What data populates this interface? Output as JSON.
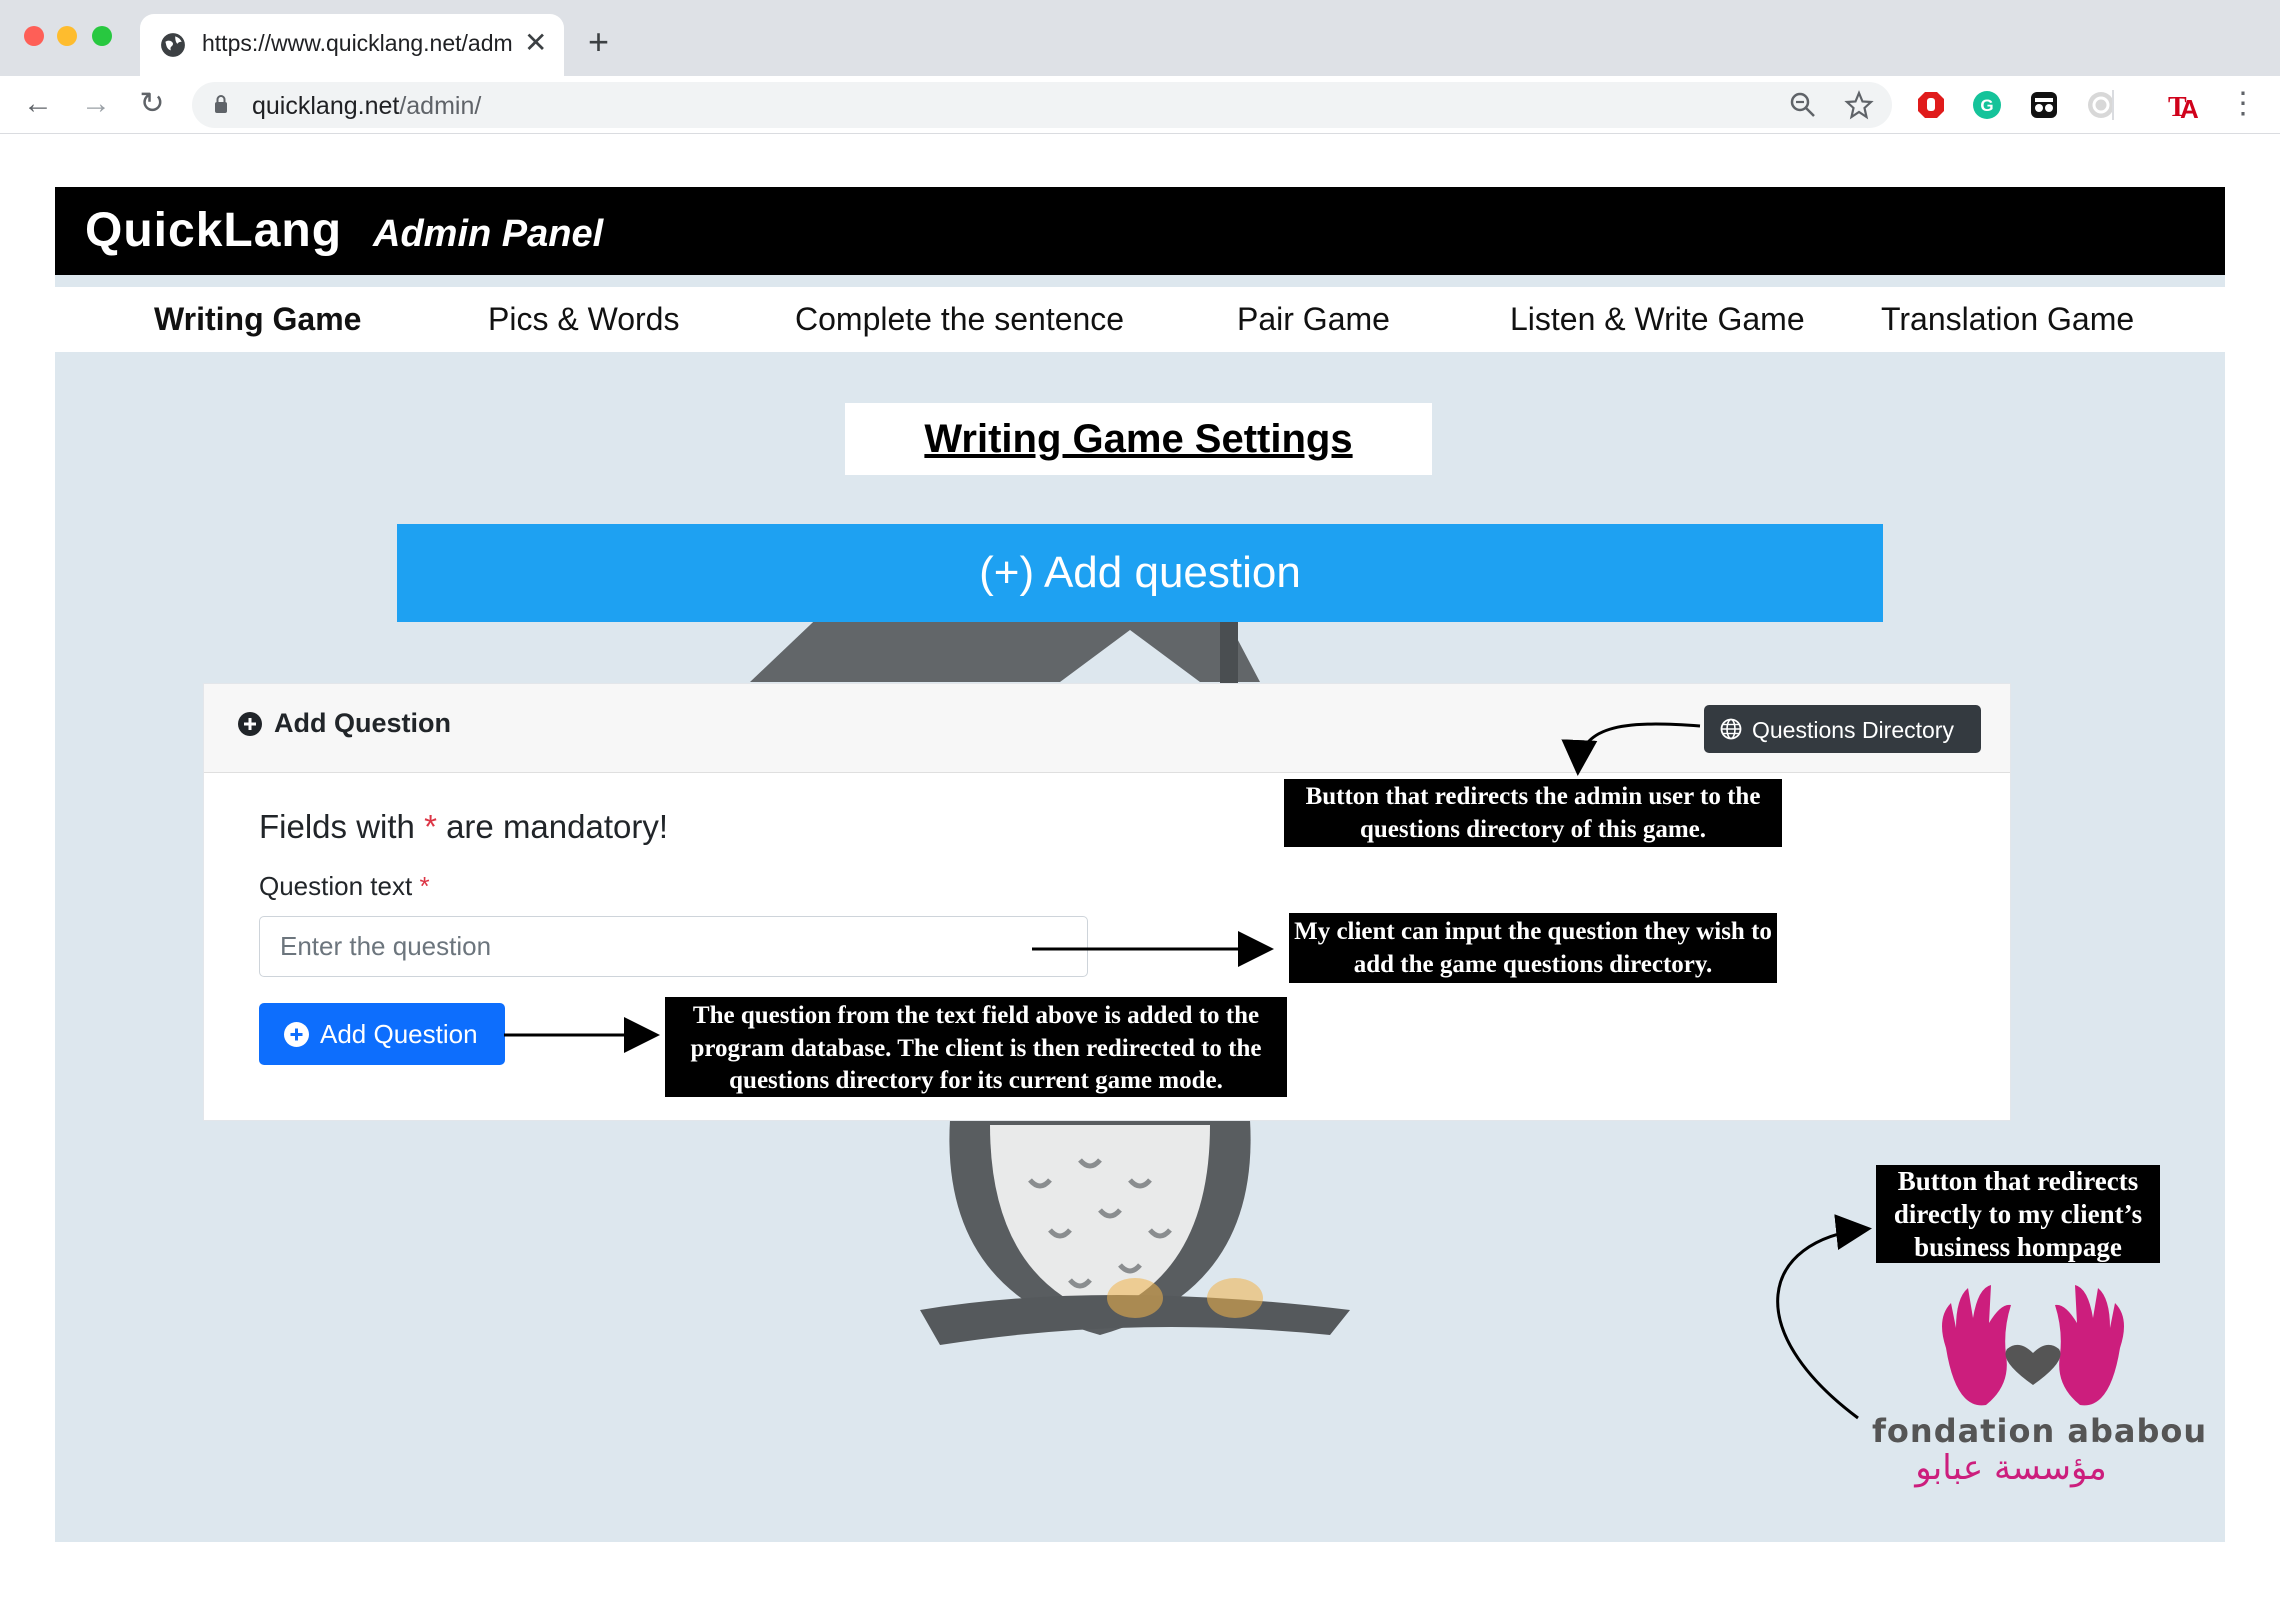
{
  "browser": {
    "tab_title": "https://www.quicklang.net/adm",
    "url_host": "quicklang.net",
    "url_path": "/admin/"
  },
  "header": {
    "brand": "QuickLang",
    "panel_title": "Admin Panel"
  },
  "nav": {
    "items": [
      {
        "label": "Writing Game",
        "active": true
      },
      {
        "label": "Pics & Words",
        "active": false
      },
      {
        "label": "Complete the sentence",
        "active": false
      },
      {
        "label": "Pair Game",
        "active": false
      },
      {
        "label": "Listen & Write Game",
        "active": false
      },
      {
        "label": "Translation Game",
        "active": false
      }
    ]
  },
  "settings_title": "Writing Game Settings",
  "add_banner_label": "(+) Add question",
  "card": {
    "header_title": "Add Question",
    "directory_button": "Questions Directory",
    "mandatory_prefix": "Fields with",
    "mandatory_star": "*",
    "mandatory_suffix": "are mandatory!",
    "question_label": "Question text",
    "question_star": "*",
    "question_placeholder": "Enter the question",
    "question_value": "",
    "add_button": "Add Question"
  },
  "annotations": {
    "directory_note": "Button that redirects the admin user to the questions directory of this game.",
    "input_note": "My client can input the question they wish to add the game questions directory.",
    "add_note": "The question from the text field above is added to the program database. The client is then redirected to the questions directory for its current game mode.",
    "logo_note": "Button that redirects directly to my client’s business hompage"
  },
  "logo": {
    "name": "fondation ababou",
    "arabic": "مؤسسة عبابو"
  },
  "colors": {
    "header_bg": "#000000",
    "banner_blue": "#1ea1f2",
    "primary_button": "#0d6efd",
    "dark_button": "#343a40",
    "page_bg": "#dde7ee",
    "logo_pink": "#cc1e7d"
  },
  "icons": {
    "tab": "globe-icon",
    "card_header": "plus-circle-icon",
    "directory_button": "globe-icon",
    "add_button": "plus-circle-icon"
  }
}
